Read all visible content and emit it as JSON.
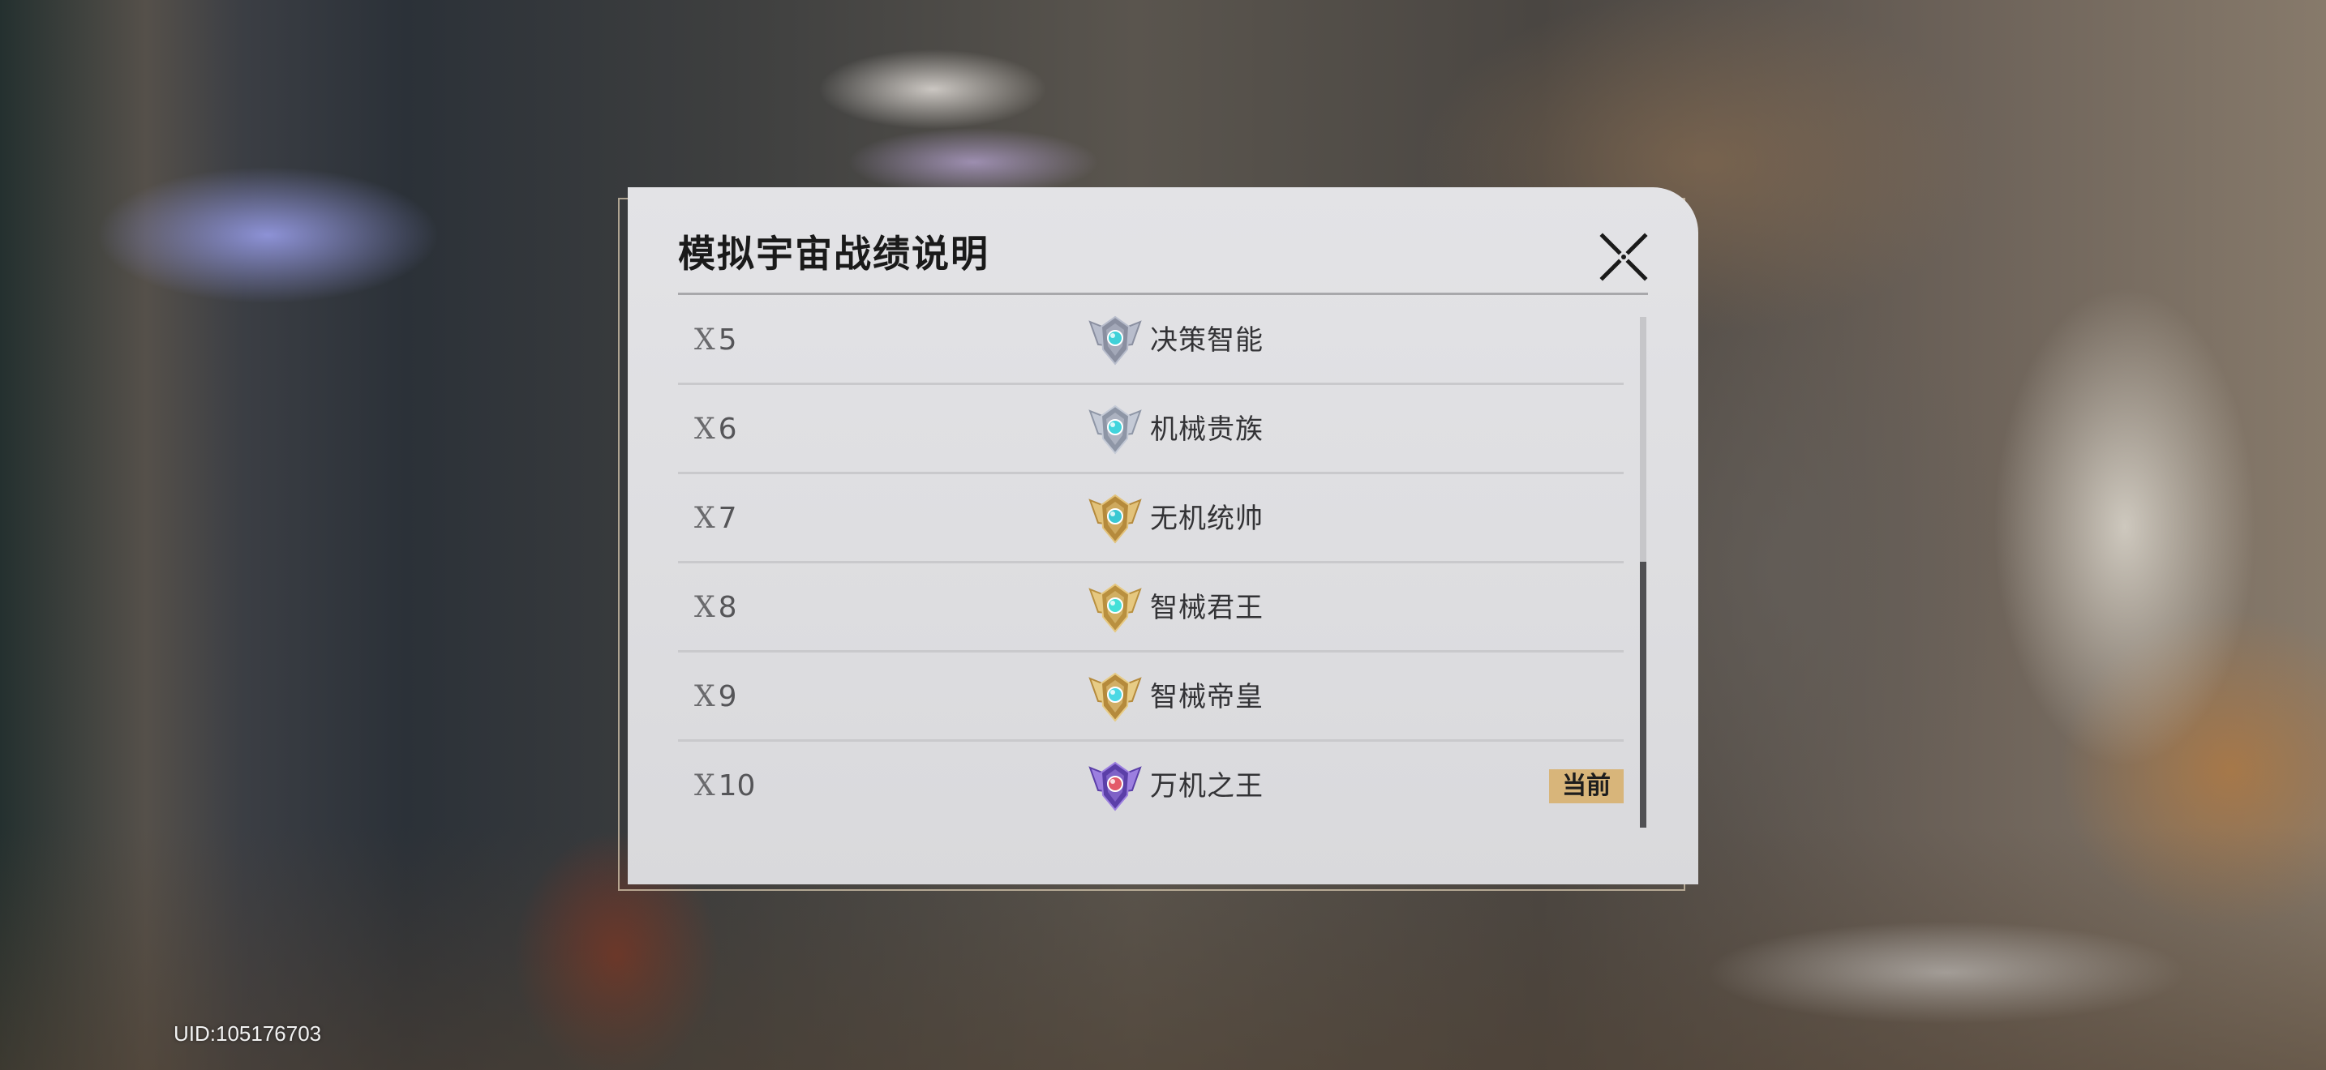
{
  "dialog": {
    "title": "模拟宇宙战绩说明",
    "close_icon": "close-x-icon",
    "rows": [
      {
        "mark": "X",
        "level": "5",
        "name": "决策智能",
        "badge_icon": "rank-badge-silver-icon",
        "badge_colors": [
          "#8a8fa0",
          "#b8bdcc",
          "#3fd1d8"
        ]
      },
      {
        "mark": "X",
        "level": "6",
        "name": "机械贵族",
        "badge_icon": "rank-badge-silver-icon",
        "badge_colors": [
          "#8e96a6",
          "#c4cad6",
          "#41d4dc"
        ]
      },
      {
        "mark": "X",
        "level": "7",
        "name": "无机统帅",
        "badge_icon": "rank-badge-gold-icon",
        "badge_colors": [
          "#b58a3c",
          "#e2c27a",
          "#3ac8d2"
        ]
      },
      {
        "mark": "X",
        "level": "8",
        "name": "智械君王",
        "badge_icon": "rank-badge-gold-teal-icon",
        "badge_colors": [
          "#b9903f",
          "#e6c880",
          "#45e0d8"
        ]
      },
      {
        "mark": "X",
        "level": "9",
        "name": "智械帝皇",
        "badge_icon": "rank-badge-gold-winged-icon",
        "badge_colors": [
          "#b58a3c",
          "#e7cc86",
          "#4bd8e4"
        ]
      },
      {
        "mark": "X",
        "level": "10",
        "name": "万机之王",
        "badge_icon": "rank-badge-violet-icon",
        "badge_colors": [
          "#5b3fa8",
          "#9c7fe0",
          "#e35a6a"
        ],
        "current_label": "当前"
      }
    ],
    "scrollbar": {
      "thumb_start_fraction": 0.48,
      "thumb_size_fraction": 0.52
    }
  },
  "footer": {
    "uid": "UID:105176703"
  },
  "colors": {
    "current_tag_bg": "#d8b57a",
    "dialog_bg": "#e0e0e3"
  }
}
